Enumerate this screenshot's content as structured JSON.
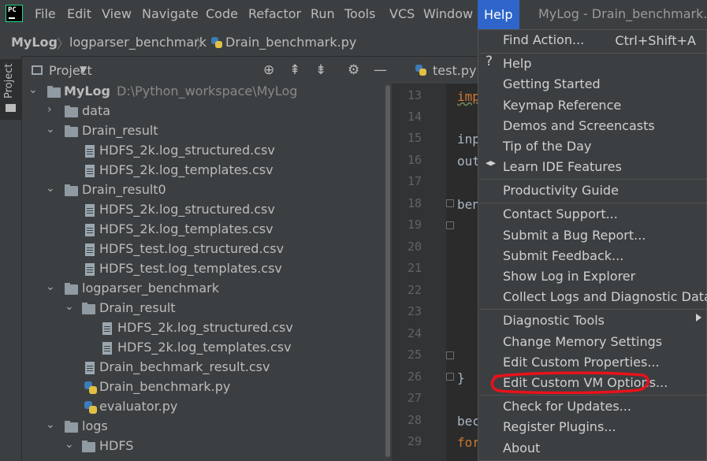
{
  "menubar": {
    "logo_text": "PC",
    "items": [
      "File",
      "Edit",
      "View",
      "Navigate",
      "Code",
      "Refactor",
      "Run",
      "Tools",
      "VCS",
      "Window",
      "Help"
    ],
    "window_title": "MyLog - Drain_benchmark.py"
  },
  "breadcrumb": {
    "items": [
      "MyLog",
      "logparser_benchmark",
      "Drain_benchmark.py"
    ]
  },
  "sidebar": {
    "tab_label": "Project"
  },
  "project_panel": {
    "title": "Project",
    "icons": [
      "locate-icon",
      "expand-all-icon",
      "collapse-all-icon",
      "gear-icon",
      "minimize-icon"
    ],
    "tree": [
      {
        "label": "MyLog",
        "path": "D:\\Python_workspace\\MyLog",
        "type": "folder",
        "expanded": true,
        "bold": true
      },
      {
        "label": "data",
        "type": "folder",
        "expanded": false
      },
      {
        "label": "Drain_result",
        "type": "folder",
        "expanded": true
      },
      {
        "label": "HDFS_2k.log_structured.csv",
        "type": "file"
      },
      {
        "label": "HDFS_2k.log_templates.csv",
        "type": "file"
      },
      {
        "label": "Drain_result0",
        "type": "folder",
        "expanded": true
      },
      {
        "label": "HDFS_2k.log_structured.csv",
        "type": "file"
      },
      {
        "label": "HDFS_2k.log_templates.csv",
        "type": "file"
      },
      {
        "label": "HDFS_test.log_structured.csv",
        "type": "file"
      },
      {
        "label": "HDFS_test.log_templates.csv",
        "type": "file"
      },
      {
        "label": "logparser_benchmark",
        "type": "folder",
        "expanded": true
      },
      {
        "label": "Drain_result",
        "type": "folder",
        "expanded": true
      },
      {
        "label": "HDFS_2k.log_structured.csv",
        "type": "file"
      },
      {
        "label": "HDFS_2k.log_templates.csv",
        "type": "file"
      },
      {
        "label": "Drain_bechmark_result.csv",
        "type": "file"
      },
      {
        "label": "Drain_benchmark.py",
        "type": "python"
      },
      {
        "label": "evaluator.py",
        "type": "python"
      },
      {
        "label": "logs",
        "type": "folder",
        "expanded": true
      },
      {
        "label": "HDFS",
        "type": "folder",
        "expanded": true
      }
    ]
  },
  "editor": {
    "tab_label": "test.py",
    "line_numbers": [
      "13",
      "14",
      "15",
      "16",
      "17",
      "18",
      "19",
      "20",
      "21",
      "22",
      "23",
      "24",
      "25",
      "26",
      "27",
      "28",
      "29"
    ],
    "code_fragments": [
      {
        "line": "13",
        "text": "imp"
      },
      {
        "line": "15",
        "text": "inp"
      },
      {
        "line": "16",
        "text": "out"
      },
      {
        "line": "18",
        "text": "ben"
      },
      {
        "line": "26",
        "text": "}"
      },
      {
        "line": "28",
        "text": "bec"
      },
      {
        "line": "29",
        "text": "for"
      }
    ]
  },
  "help_menu": {
    "items": [
      {
        "label": "Find Action...",
        "shortcut": "Ctrl+Shift+A"
      },
      {
        "label": "Help",
        "icon": "question-icon"
      },
      {
        "label": "Getting Started"
      },
      {
        "label": "Keymap Reference"
      },
      {
        "label": "Demos and Screencasts"
      },
      {
        "label": "Tip of the Day"
      },
      {
        "label": "Learn IDE Features",
        "icon": "graduation-cap-icon"
      },
      {
        "label": "Productivity Guide"
      },
      {
        "label": "Contact Support..."
      },
      {
        "label": "Submit a Bug Report..."
      },
      {
        "label": "Submit Feedback..."
      },
      {
        "label": "Show Log in Explorer"
      },
      {
        "label": "Collect Logs and Diagnostic Data"
      },
      {
        "label": "Diagnostic Tools",
        "submenu": true
      },
      {
        "label": "Change Memory Settings"
      },
      {
        "label": "Edit Custom Properties..."
      },
      {
        "label": "Edit Custom VM Options...",
        "highlighted_annotation": true
      },
      {
        "label": "Check for Updates..."
      },
      {
        "label": "Register Plugins..."
      },
      {
        "label": "About"
      }
    ]
  },
  "colors": {
    "menubar_bg": "#3c3f41",
    "editor_bg": "#2b2b2b",
    "selected_menu": "#2f65ca",
    "annotation_red": "#e8121b",
    "folder": "#8f9aa3"
  }
}
